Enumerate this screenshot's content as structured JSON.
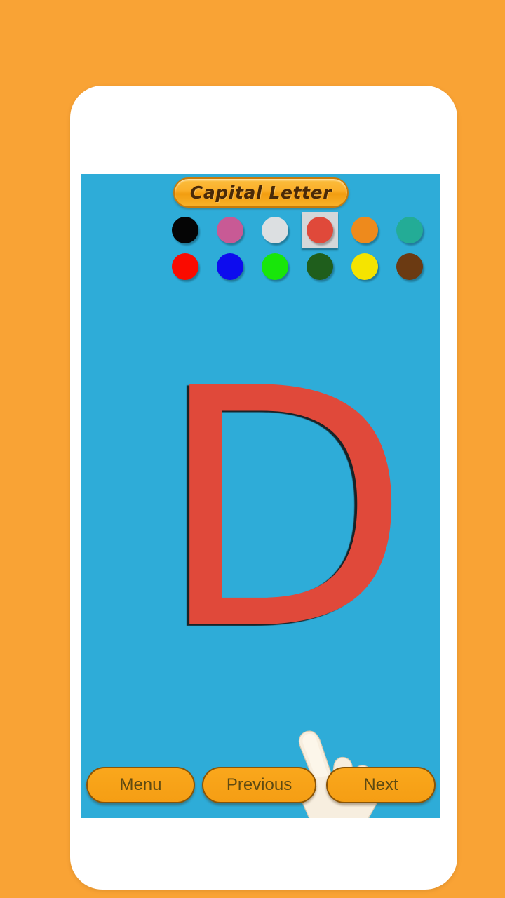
{
  "theme": {
    "page_background": "#F9A335",
    "phone_body": "#FFFFFF",
    "screen_background": "#2EACD8",
    "accent_orange": "#FAA71C",
    "accent_orange_border": "#8A5406",
    "title_text_color": "#4A2A08",
    "button_text_color": "#5E4A12"
  },
  "app": {
    "title": "Capital Letter",
    "current_letter": "D",
    "letter_color": "#E0493A"
  },
  "palette": {
    "selected_index": 3,
    "rows": [
      {
        "swatches": [
          {
            "name": "black",
            "hex": "#050505"
          },
          {
            "name": "pink",
            "hex": "#C85A95"
          },
          {
            "name": "white",
            "hex": "#DCDFE1"
          },
          {
            "name": "red-tomato",
            "hex": "#E0493A"
          },
          {
            "name": "orange",
            "hex": "#EE8A1C"
          },
          {
            "name": "teal",
            "hex": "#23AC96"
          },
          {
            "name": "green",
            "hex": "#2ECC60"
          },
          {
            "name": "blue-steel",
            "hex": "#4189D8"
          }
        ]
      },
      {
        "swatches": [
          {
            "name": "pure-red",
            "hex": "#FA0B00"
          },
          {
            "name": "pure-blue",
            "hex": "#0D0CEE"
          },
          {
            "name": "bright-green",
            "hex": "#18E60A"
          },
          {
            "name": "dark-green",
            "hex": "#1F5E1C"
          },
          {
            "name": "yellow",
            "hex": "#F5E400"
          },
          {
            "name": "brown",
            "hex": "#6B3A12"
          },
          {
            "name": "purple",
            "hex": "#5C1480"
          },
          {
            "name": "cyan",
            "hex": "#14E9F7"
          }
        ]
      }
    ]
  },
  "bottom_nav": {
    "menu_label": "Menu",
    "previous_label": "Previous",
    "next_label": "Next"
  },
  "cursor": {
    "icon": "pointing-hand-icon",
    "skin_color": "#F7EEDF",
    "shade_color": "#E4D8C4"
  }
}
